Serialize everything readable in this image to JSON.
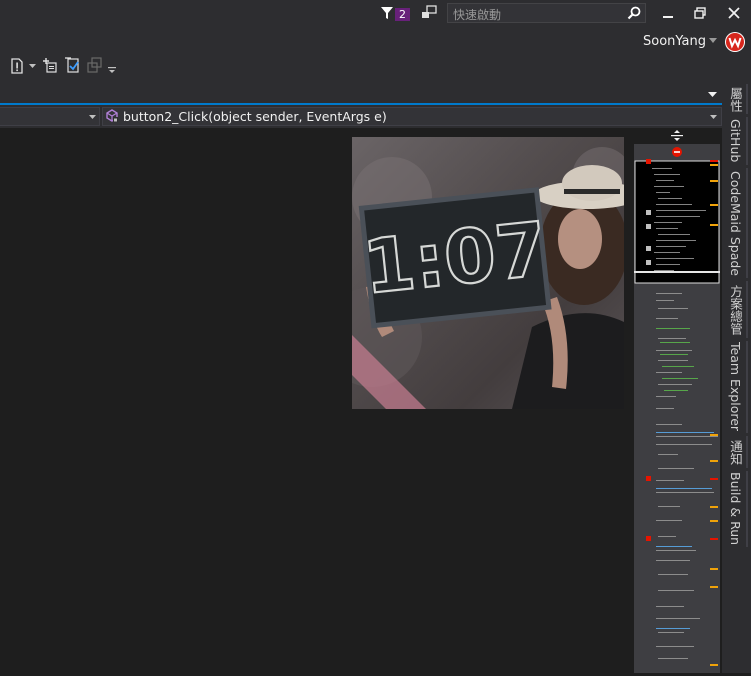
{
  "titlebar": {
    "notification_count": "2",
    "quick_launch_placeholder": "快速啟動",
    "username": "SoonYang",
    "avatar_letter": "W"
  },
  "navbar": {
    "method_label": "button2_Click(object sender, EventArgs e)"
  },
  "editor": {
    "image_text": "1:07"
  },
  "side_tabs": [
    {
      "label": "屬性"
    },
    {
      "label": "GitHub"
    },
    {
      "label": "CodeMaid Spade"
    },
    {
      "label": "方案總管"
    },
    {
      "label": "Team Explorer"
    },
    {
      "label": "通知"
    },
    {
      "label": "Build & Run"
    }
  ],
  "colors": {
    "accent": "#007acc",
    "badge": "#68217a",
    "background": "#1e1e1e",
    "chrome": "#2d2d30"
  }
}
